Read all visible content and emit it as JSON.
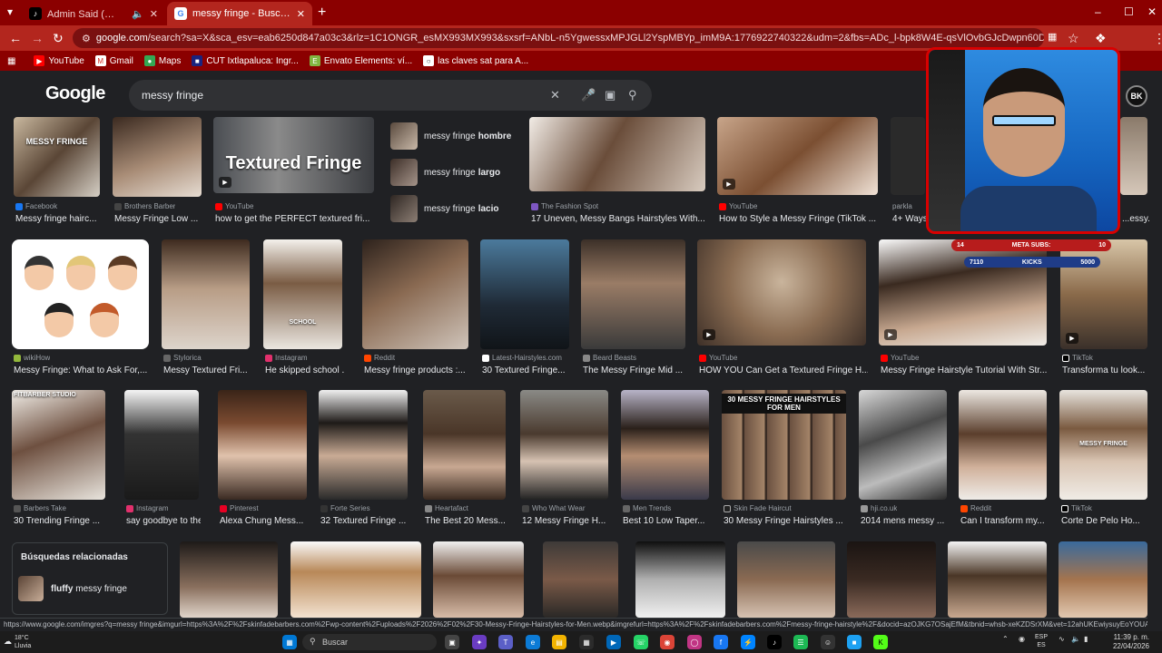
{
  "tabs": [
    {
      "title": "Admin Said (✨BoyDeConfi...",
      "active": false
    },
    {
      "title": "messy fringe - Buscar con Goo...",
      "active": true
    }
  ],
  "omnibox": {
    "host": "google.com",
    "path": "/search?sa=X&sca_esv=eab6250d847a03c3&rlz=1C1ONGR_esMX993MX993&sxsrf=ANbL-n5YgwessxMPJGLl2YspMBYp_imM9A:1776922740322&udm=2&fbs=ADc_l-bpk8W4E-qsVlOvbGJcDwpn60DczFdcvPnuv8WQohHLTaf9fS4tJ71bi2aH..."
  },
  "bookmarks": [
    "YouTube",
    "Gmail",
    "Maps",
    "CUT Ixtlapaluca: Ingr...",
    "Envato Elements: ví...",
    "las claves sat para A..."
  ],
  "google": {
    "logo": "Google",
    "query": "messy fringe",
    "avatar": "BK"
  },
  "suggestions": [
    {
      "prefix": "messy fringe",
      "bold": "hombre"
    },
    {
      "prefix": "messy fringe",
      "bold": "largo"
    },
    {
      "prefix": "messy fringe",
      "bold": "lacio"
    }
  ],
  "row1": [
    {
      "source": "Facebook",
      "caption": "Messy fringe hairc...",
      "overlay": "MESSY FRINGE"
    },
    {
      "source": "Brothers Barber",
      "caption": "Messy Fringe Low ..."
    },
    {
      "source": "YouTube",
      "caption": "how to get the PERFECT textured fri...",
      "overlay": "Textured Fringe"
    },
    {
      "source": "The Fashion Spot",
      "caption": "17 Uneven, Messy Bangs Hairstyles With..."
    },
    {
      "source": "YouTube",
      "caption": "How to Style a Messy Fringe (TikTok ..."
    },
    {
      "source": "parkla",
      "caption": "4+ Ways..."
    },
    {
      "source": "",
      "caption": "...essy..."
    }
  ],
  "row2": [
    {
      "source": "wikiHow",
      "caption": "Messy Fringe: What to Ask For,..."
    },
    {
      "source": "Stylorica",
      "caption": "Messy Textured Fri..."
    },
    {
      "source": "Instagram",
      "caption": "He skipped school ...",
      "overlay": "SCHOOL"
    },
    {
      "source": "Reddit",
      "caption": "Messy fringe products :..."
    },
    {
      "source": "Latest-Hairstyles.com",
      "caption": "30 Textured Fringe..."
    },
    {
      "source": "Beard Beasts",
      "caption": "The Messy Fringe Mid ..."
    },
    {
      "source": "YouTube",
      "caption": "HOW YOU Can Get a Textured Fringe H..."
    },
    {
      "source": "YouTube",
      "caption": "Messy Fringe Hairstyle Tutorial With Str..."
    },
    {
      "source": "TikTok",
      "caption": "Transforma tu look..."
    }
  ],
  "row3": [
    {
      "source": "Barbers Take",
      "caption": "30 Trending Fringe ...",
      "overlay": "FITBARBER STUDIO"
    },
    {
      "source": "Instagram",
      "caption": "say goodbye to the..."
    },
    {
      "source": "Pinterest",
      "caption": "Alexa Chung Mess..."
    },
    {
      "source": "Forte Series",
      "caption": "32 Textured Fringe ..."
    },
    {
      "source": "Heartafact",
      "caption": "The Best 20 Mess..."
    },
    {
      "source": "Who What Wear",
      "caption": "12 Messy Fringe H..."
    },
    {
      "source": "Men Trends",
      "caption": "Best 10 Low Taper..."
    },
    {
      "source": "Skin Fade Haircut",
      "caption": "30 Messy Fringe Hairstyles ...",
      "overlay": "30 MESSY FRINGE HAIRSTYLES FOR MEN"
    },
    {
      "source": "hji.co.uk",
      "caption": "2014 mens messy ..."
    },
    {
      "source": "Reddit",
      "caption": "Can I transform my..."
    },
    {
      "source": "TikTok",
      "caption": "Corte De Pelo Ho...",
      "overlay": "MESSY FRINGE"
    }
  ],
  "related": {
    "header": "Búsquedas relacionadas",
    "item_bold": "fluffy",
    "item_rest": "messy fringe"
  },
  "stream": {
    "subs_left": "14",
    "subs_label": "META SUBS:",
    "subs_right": "10",
    "kicks_left": "7110",
    "kicks_label": "KICKS",
    "kicks_right": "5000"
  },
  "status_url": "https://www.google.com/imgres?q=messy fringe&imgurl=https%3A%2F%2Fskinfadebarbers.com%2Fwp-content%2Fuploads%2F2026%2F02%2F30-Messy-Fringe-Hairstyles-for-Men.webp&imgrefurl=https%3A%2F%2Fskinfadebarbers.com%2Fmessy-fringe-hairstyle%2F&docid=azOJKG7OSajEfM&tbnid=whsb-xeKZDSrXM&vet=12ahUKEwiysuyEoYOUA...",
  "taskbar": {
    "temp": "18°C",
    "weather": "Lluvia",
    "search_placeholder": "Buscar",
    "lang1": "ESP",
    "lang2": "ES",
    "time": "11:39 p. m.",
    "date": "22/04/2026"
  }
}
